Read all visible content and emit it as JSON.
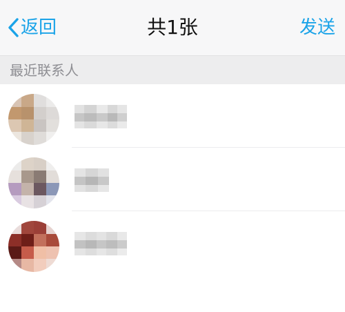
{
  "navbar": {
    "back_label": "返回",
    "title": "共1张",
    "send_label": "发送",
    "accent_color": "#1aa3e8"
  },
  "section": {
    "label": "最近联系人"
  },
  "contacts": [
    {
      "name": "",
      "avatar": "pixelated-avatar-1",
      "name_obscured": true
    },
    {
      "name": "",
      "avatar": "pixelated-avatar-2",
      "name_obscured": true
    },
    {
      "name": "",
      "avatar": "pixelated-avatar-3",
      "name_obscured": true
    }
  ]
}
